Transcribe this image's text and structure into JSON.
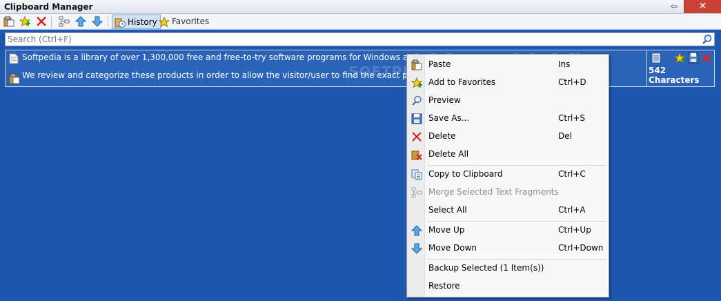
{
  "window": {
    "title": "Clipboard Manager",
    "pin_glyph": "⇦",
    "close_glyph": "✕"
  },
  "toolbar": {
    "buttons": [
      {
        "name": "paste-icon"
      },
      {
        "name": "add-favorite-icon"
      },
      {
        "name": "delete-icon"
      },
      {
        "name": "merge-icon"
      },
      {
        "name": "move-up-icon"
      },
      {
        "name": "move-down-icon"
      }
    ],
    "tabs": [
      {
        "label": "History",
        "active": true
      },
      {
        "label": "Favorites",
        "active": false
      }
    ]
  },
  "search": {
    "placeholder": "Search (Ctrl+F)"
  },
  "clip": {
    "line1": "Softpedia is a library of over 1,300,000 free and free-to-try software programs for Windows and Unix/Linux, games and reviewed articles.",
    "line2": "We review and categorize these products in order to allow the visitor/user to find the exact product they and their s",
    "characters": "542 Characters"
  },
  "watermark": "SOFTPEDIA",
  "context_menu": {
    "items": [
      {
        "label": "Paste",
        "shortcut": "Ins",
        "icon": "paste-icon",
        "enabled": true
      },
      {
        "label": "Add to Favorites",
        "shortcut": "Ctrl+D",
        "icon": "add-favorite-icon",
        "enabled": true
      },
      {
        "label": "Preview",
        "shortcut": "",
        "icon": "magnifier-icon",
        "enabled": true
      },
      {
        "label": "Save As...",
        "shortcut": "Ctrl+S",
        "icon": "save-icon",
        "enabled": true
      },
      {
        "label": "Delete",
        "shortcut": "Del",
        "icon": "delete-icon",
        "enabled": true
      },
      {
        "label": "Delete All",
        "shortcut": "",
        "icon": "delete-all-icon",
        "enabled": true
      },
      {
        "label": "Copy to Clipboard",
        "shortcut": "Ctrl+C",
        "icon": "copy-icon",
        "enabled": true
      },
      {
        "label": "Merge Selected Text Fragments",
        "shortcut": "",
        "icon": "merge-icon",
        "enabled": false
      },
      {
        "label": "Select All",
        "shortcut": "Ctrl+A",
        "icon": "",
        "enabled": true
      },
      {
        "label": "Move Up",
        "shortcut": "Ctrl+Up",
        "icon": "move-up-icon",
        "enabled": true
      },
      {
        "label": "Move Down",
        "shortcut": "Ctrl+Down",
        "icon": "move-down-icon",
        "enabled": true
      },
      {
        "label": "Backup Selected (1 Item(s))",
        "shortcut": "",
        "icon": "",
        "enabled": true
      },
      {
        "label": "Restore",
        "shortcut": "",
        "icon": "",
        "enabled": true
      }
    ]
  },
  "colors": {
    "background": "#1d58b0",
    "clip_bg": "#2b63b8",
    "close_button": "#c94235",
    "tab_active": "#d0e2f6"
  }
}
